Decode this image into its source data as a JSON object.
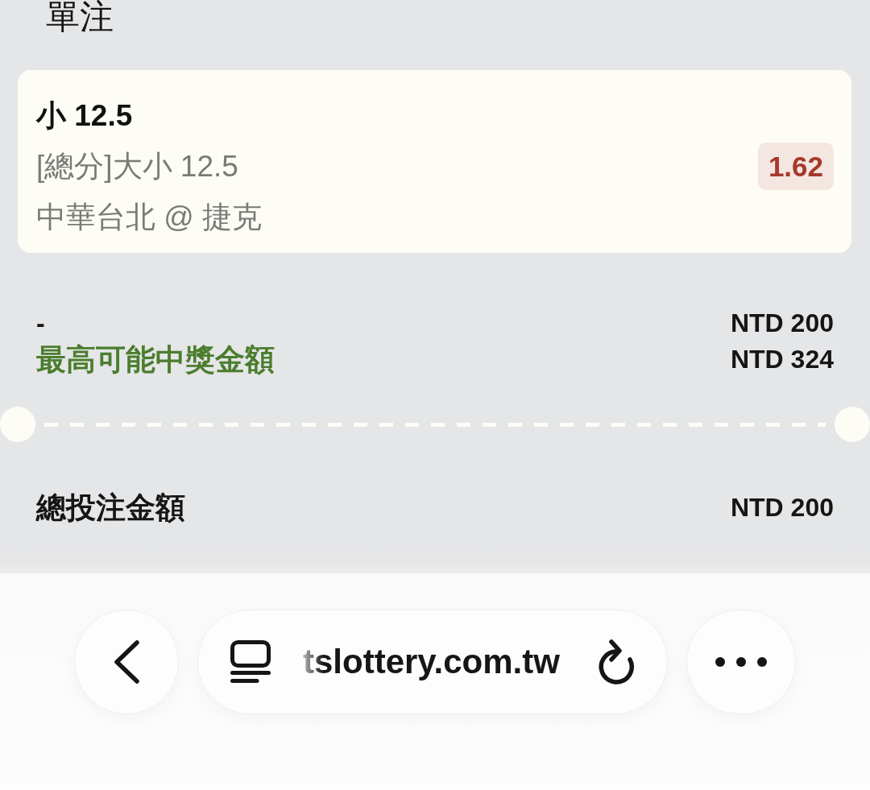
{
  "header": {
    "title": "單注"
  },
  "bet_card": {
    "selection": "小 12.5",
    "market": "[總分]大小 12.5",
    "match": "中華台北 @ 捷克",
    "odds": "1.62"
  },
  "summary_rows": [
    {
      "kind": "plain",
      "label": "-",
      "value": "NTD 200"
    },
    {
      "kind": "highlight",
      "label": "最高可能中獎金額",
      "value": "NTD 324"
    }
  ],
  "total": {
    "label": "總投注金額",
    "value": "NTD 200"
  },
  "browser_bar": {
    "url": "tslottery.com.tw"
  }
}
